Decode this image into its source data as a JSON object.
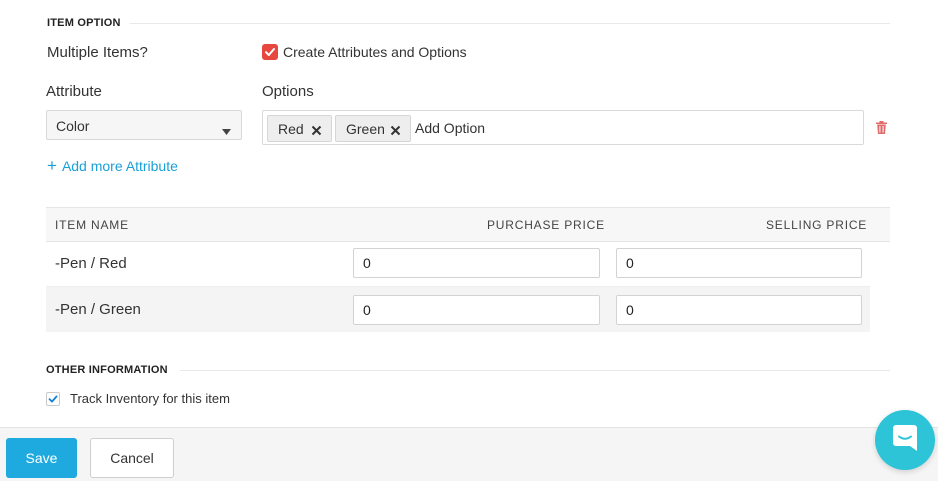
{
  "item_option": {
    "section_title": "ITEM OPTION",
    "multiple_items_label": "Multiple Items?",
    "create_checkbox_label": "Create Attributes and Options",
    "attribute_label": "Attribute",
    "options_label": "Options",
    "attribute_value": "Color",
    "options": [
      "Red",
      "Green"
    ],
    "add_option_placeholder": "Add Option",
    "add_more_attribute": "Add more Attribute",
    "add_more_prefix": "+"
  },
  "table": {
    "headers": {
      "item_name": "ITEM NAME",
      "purchase_price": "PURCHASE PRICE",
      "selling_price": "SELLING PRICE"
    },
    "rows": [
      {
        "name": "-Pen / Red",
        "purchase_price": "0",
        "selling_price": "0"
      },
      {
        "name": "-Pen / Green",
        "purchase_price": "0",
        "selling_price": "0"
      }
    ]
  },
  "other_information": {
    "section_title": "OTHER INFORMATION",
    "track_inventory_label": "Track Inventory for this item",
    "track_inventory_checked": true
  },
  "footer": {
    "save_label": "Save",
    "cancel_label": "Cancel"
  },
  "colors": {
    "accent": "#1a9fd8",
    "save_button": "#1eaadf",
    "checkbox_red": "#e8473f",
    "chat_bubble": "#2cc4d6",
    "delete_icon": "#e06b6b"
  }
}
